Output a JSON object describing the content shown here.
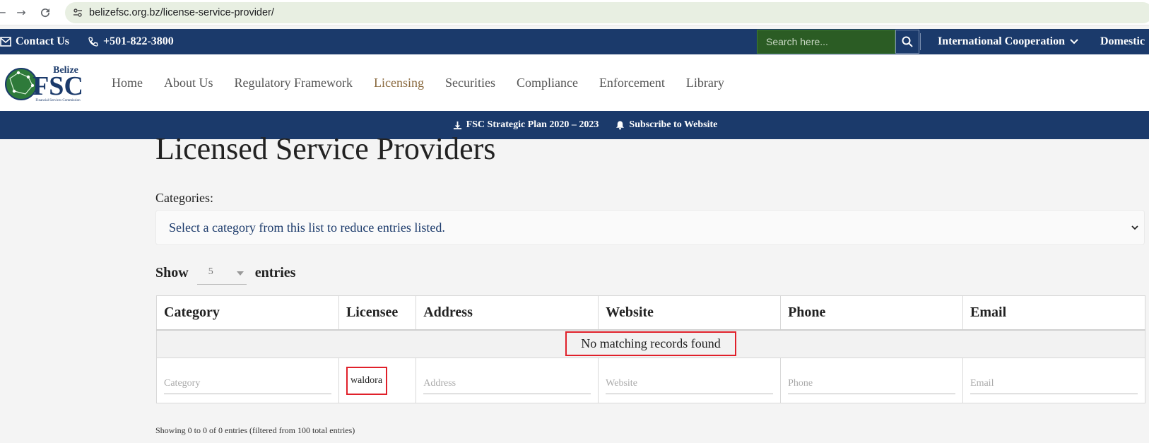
{
  "browser": {
    "url": "belizefsc.org.bz/license-service-provider/"
  },
  "top_bar": {
    "contact_label": "Contact Us",
    "phone": "+501-822-3800",
    "search_placeholder": "Search here...",
    "international_cooperation": "International Cooperation",
    "domestic": "Domestic"
  },
  "logo": {
    "line1": "Belize",
    "line2": "FSC",
    "tagline": "Financial Services Commission"
  },
  "main_nav": {
    "items": [
      "Home",
      "About Us",
      "Regulatory Framework",
      "Licensing",
      "Securities",
      "Compliance",
      "Enforcement",
      "Library"
    ]
  },
  "info_bar": {
    "strategic_plan": "FSC Strategic Plan 2020 – 2023",
    "subscribe": "Subscribe to Website"
  },
  "content": {
    "title": "Licensed Service Providers",
    "categories_label": "Categories:",
    "category_select": "Select a category from this list to reduce entries listed.",
    "show_label": "Show",
    "entries_value": "5",
    "entries_label": "entries"
  },
  "table": {
    "columns": [
      "Category",
      "Licensee",
      "Address",
      "Website",
      "Phone",
      "Email"
    ],
    "empty_message": "No matching records found",
    "filters": {
      "category_placeholder": "Category",
      "licensee_value": "waldora",
      "address_placeholder": "Address",
      "website_placeholder": "Website",
      "phone_placeholder": "Phone",
      "email_placeholder": "Email"
    }
  },
  "footer": {
    "showing_info": "Showing 0 to 0 of 0 entries (filtered from 100 total entries)"
  },
  "colors": {
    "navy": "#1b3a6b",
    "search_green": "#2b5c24",
    "active_nav": "#8a6a3f",
    "highlight_red": "#e0202a"
  }
}
